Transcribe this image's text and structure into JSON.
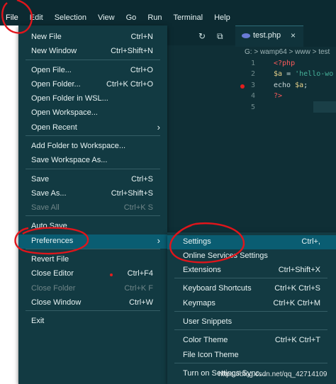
{
  "menubar": {
    "items": [
      "File",
      "Edit",
      "Selection",
      "View",
      "Go",
      "Run",
      "Terminal",
      "Help"
    ]
  },
  "tab": {
    "label": "test.php",
    "close": "×"
  },
  "breadcrumb": "G: > wamp64 > www > test",
  "code_lines": [
    {
      "num": "1",
      "parts": [
        {
          "t": "<?php",
          "c": "k-tag"
        }
      ]
    },
    {
      "num": "2",
      "parts": [
        {
          "t": "$a",
          "c": "k-var"
        },
        {
          "t": " = ",
          "c": "k-op"
        },
        {
          "t": "'hello-wo",
          "c": "k-str"
        }
      ]
    },
    {
      "num": "3",
      "parts": [
        {
          "t": "echo ",
          "c": "k-kw"
        },
        {
          "t": "$a",
          "c": "k-var"
        },
        {
          "t": ";",
          "c": "k-op"
        }
      ],
      "breakpoint": true
    },
    {
      "num": "4",
      "parts": [
        {
          "t": "?>",
          "c": "k-tag"
        }
      ]
    },
    {
      "num": "5",
      "parts": []
    }
  ],
  "file_menu": {
    "groups": [
      [
        {
          "label": "New File",
          "shortcut": "Ctrl+N"
        },
        {
          "label": "New Window",
          "shortcut": "Ctrl+Shift+N"
        }
      ],
      [
        {
          "label": "Open File...",
          "shortcut": "Ctrl+O"
        },
        {
          "label": "Open Folder...",
          "shortcut": "Ctrl+K Ctrl+O"
        },
        {
          "label": "Open Folder in WSL...",
          "shortcut": ""
        },
        {
          "label": "Open Workspace...",
          "shortcut": ""
        },
        {
          "label": "Open Recent",
          "shortcut": "",
          "submenu": true
        }
      ],
      [
        {
          "label": "Add Folder to Workspace...",
          "shortcut": ""
        },
        {
          "label": "Save Workspace As...",
          "shortcut": ""
        }
      ],
      [
        {
          "label": "Save",
          "shortcut": "Ctrl+S"
        },
        {
          "label": "Save As...",
          "shortcut": "Ctrl+Shift+S"
        },
        {
          "label": "Save All",
          "shortcut": "Ctrl+K S",
          "disabled": true
        }
      ],
      [
        {
          "label": "Auto Save",
          "shortcut": ""
        },
        {
          "label": "Preferences",
          "shortcut": "",
          "submenu": true,
          "highlighted": true
        }
      ],
      [
        {
          "label": "Revert File",
          "shortcut": ""
        },
        {
          "label": "Close Editor",
          "shortcut": "Ctrl+F4"
        },
        {
          "label": "Close Folder",
          "shortcut": "Ctrl+K F",
          "disabled": true
        },
        {
          "label": "Close Window",
          "shortcut": "Ctrl+W"
        }
      ],
      [
        {
          "label": "Exit",
          "shortcut": ""
        }
      ]
    ]
  },
  "preferences_menu": {
    "groups": [
      [
        {
          "label": "Settings",
          "shortcut": "Ctrl+,",
          "highlighted": true
        },
        {
          "label": "Online Services Settings",
          "shortcut": ""
        },
        {
          "label": "Extensions",
          "shortcut": "Ctrl+Shift+X"
        }
      ],
      [
        {
          "label": "Keyboard Shortcuts",
          "shortcut": "Ctrl+K Ctrl+S"
        },
        {
          "label": "Keymaps",
          "shortcut": "Ctrl+K Ctrl+M"
        }
      ],
      [
        {
          "label": "User Snippets",
          "shortcut": ""
        }
      ],
      [
        {
          "label": "Color Theme",
          "shortcut": "Ctrl+K Ctrl+T"
        },
        {
          "label": "File Icon Theme",
          "shortcut": ""
        }
      ],
      [
        {
          "label": "Turn on Settings Sync...",
          "shortcut": ""
        }
      ]
    ]
  },
  "watermark": "https://blog.csdn.net/qq_42714109",
  "colors": {
    "highlight": "#0a5d72",
    "annotation": "#e0151b",
    "menu_bg": "#123a42"
  }
}
